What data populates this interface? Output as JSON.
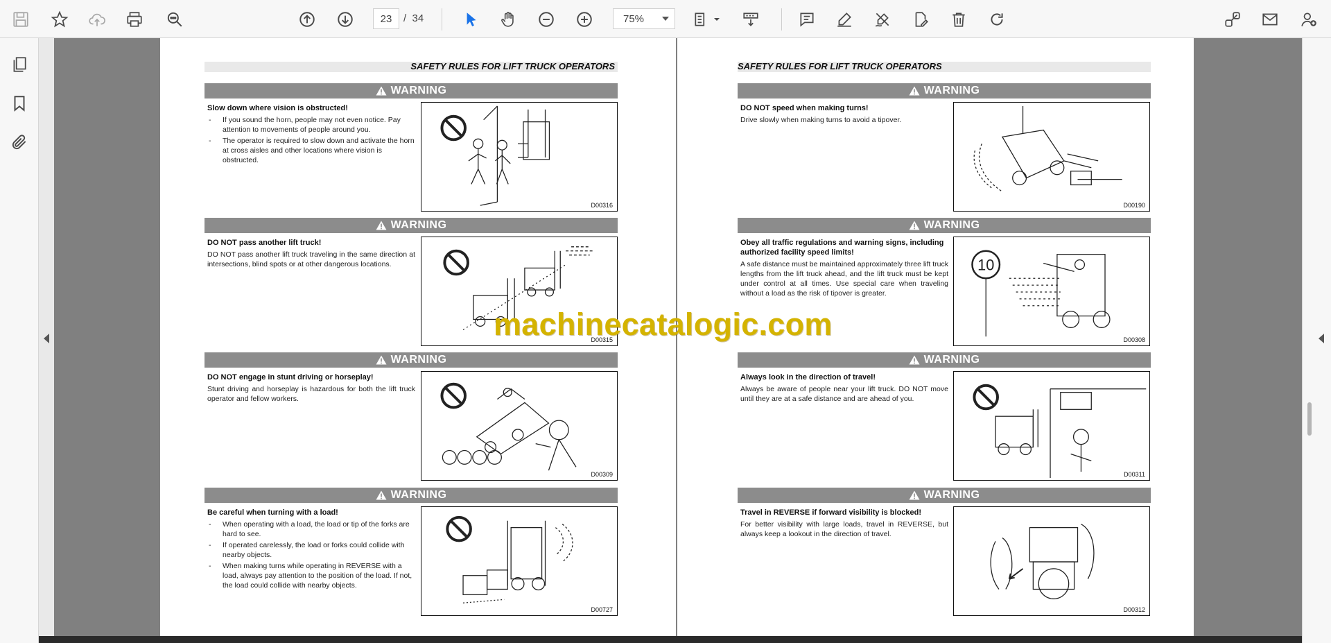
{
  "toolbar": {
    "page_current": "23",
    "page_separator": "/",
    "page_total": "34",
    "zoom_value": "75%"
  },
  "document": {
    "header_title": "SAFETY RULES FOR LIFT TRUCK OPERATORS",
    "warning_label": "WARNING",
    "watermark": "machinecatalogic.com",
    "left_page": [
      {
        "title": "Slow down where vision is obstructed!",
        "bullets": [
          "If you sound the horn, people may not even notice. Pay attention to movements of people around you.",
          "The operator is required to slow down and activate the horn at cross aisles and other locations where vision is obstructed."
        ],
        "code": "D00316"
      },
      {
        "title": "DO NOT pass another lift truck!",
        "body": "DO NOT pass another lift truck traveling in the same direction at intersections, blind spots or at other dangerous locations.",
        "code": "D00315"
      },
      {
        "title": "DO NOT engage in stunt driving or horseplay!",
        "body": "Stunt driving and horseplay is hazardous for both the lift truck operator and fellow workers.",
        "code": "D00309"
      },
      {
        "title": "Be careful when turning with a load!",
        "bullets": [
          "When operating with a load, the load or tip of the forks are hard to see.",
          "If operated carelessly, the load or forks could collide with nearby objects.",
          "When making turns while operating in REVERSE with a load, always pay attention to the position of the load. If not, the load could collide with nearby objects."
        ],
        "code": "D00727"
      }
    ],
    "right_page": [
      {
        "title": "DO NOT speed when making turns!",
        "body": "Drive slowly when making turns to avoid a tipover.",
        "code": "D00190"
      },
      {
        "title": "Obey all traffic regulations and warning signs, including authorized facility speed limits!",
        "body": "A safe distance must be maintained approximately three lift truck lengths from the lift truck ahead, and the lift truck must be kept under control at all times. Use special care when traveling without a load as the risk of tipover is greater.",
        "sign_text": "10",
        "code": "D00308"
      },
      {
        "title": "Always look in the direction of travel!",
        "body": "Always be aware of people near your lift truck. DO NOT move until they are at a safe distance and are ahead of you.",
        "code": "D00311"
      },
      {
        "title": "Travel in REVERSE if forward visibility is blocked!",
        "body": "For better visibility with large loads, travel in REVERSE, but always keep a lookout in the direction of travel.",
        "code": "D00312"
      }
    ]
  },
  "colors": {
    "accent_blue": "#1a73e8",
    "icon_gray": "#4a4a4a",
    "warning_bar": "#8c8c8c",
    "viewer_bg": "#808080",
    "watermark": "#d4b300"
  }
}
